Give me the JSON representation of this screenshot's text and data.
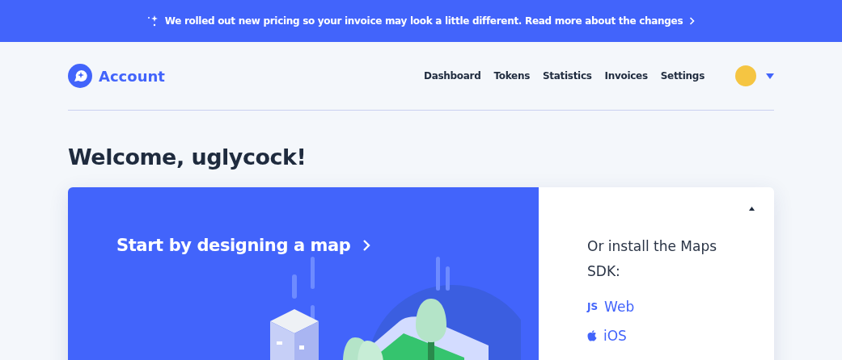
{
  "banner": {
    "text": "We rolled out new pricing so your invoice may look a little different. Read more about the changes"
  },
  "header": {
    "brand": "Account",
    "nav": [
      {
        "label": "Dashboard"
      },
      {
        "label": "Tokens"
      },
      {
        "label": "Statistics"
      },
      {
        "label": "Invoices"
      },
      {
        "label": "Settings"
      }
    ]
  },
  "welcome": "Welcome, uglycock!",
  "card": {
    "cta": "Start by designing a map",
    "sdk_intro": "Or install the Maps SDK:",
    "sdk_links": [
      {
        "kind": "js",
        "badge": "JS",
        "label": "Web"
      },
      {
        "kind": "apple",
        "label": "iOS"
      }
    ]
  }
}
